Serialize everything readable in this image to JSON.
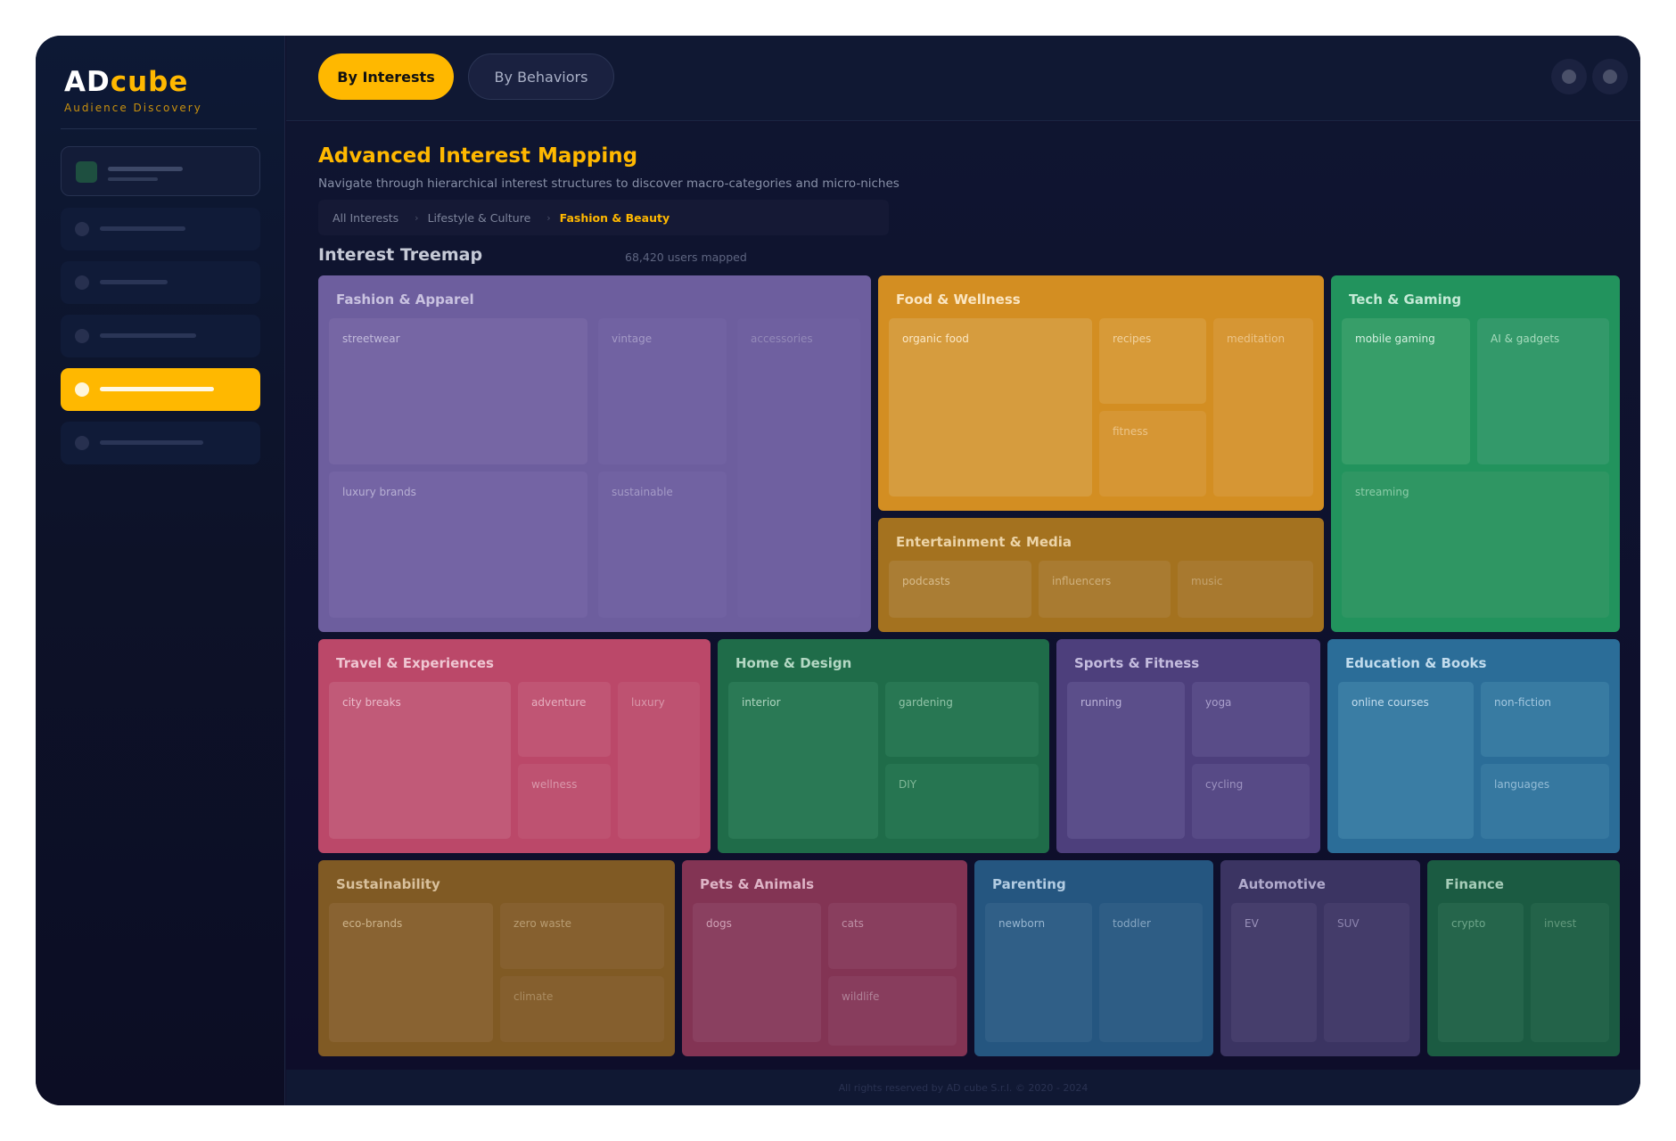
{
  "app": {
    "logo_part1": "AD",
    "logo_part2": "cube",
    "logo_subtitle": "Audience Discovery",
    "accent_color": "#ffb800"
  },
  "tabs": [
    {
      "label": "By Interests",
      "active": true
    },
    {
      "label": "By Behaviors",
      "active": false
    }
  ],
  "main": {
    "title": "Advanced Interest Mapping",
    "subtitle": "Navigate through hierarchical interest structures to discover macro-categories and micro-niches",
    "breadcrumb": [
      "All Interests",
      "Lifestyle & Culture",
      "Fashion & Beauty"
    ],
    "breadcrumb_separator": "›",
    "treemap_title": "Interest Treemap",
    "treemap_count": "68,420 users mapped"
  },
  "treemap": {
    "fashion": {
      "title": "Fashion & Apparel",
      "subs": [
        "streetwear",
        "vintage",
        "accessories",
        "luxury brands",
        "sustainable"
      ]
    },
    "food": {
      "title": "Food & Wellness",
      "subs": [
        "organic food",
        "recipes",
        "meditation",
        "fitness"
      ]
    },
    "entertainment": {
      "title": "Entertainment & Media",
      "subs": [
        "podcasts",
        "influencers",
        "music"
      ]
    },
    "tech": {
      "title": "Tech & Gaming",
      "subs": [
        "mobile gaming",
        "AI & gadgets",
        "streaming"
      ]
    },
    "travel": {
      "title": "Travel & Experiences",
      "subs": [
        "city breaks",
        "adventure",
        "luxury",
        "wellness"
      ]
    },
    "home": {
      "title": "Home & Design",
      "subs": [
        "interior",
        "gardening",
        "DIY"
      ]
    },
    "sports": {
      "title": "Sports & Fitness",
      "subs": [
        "running",
        "yoga",
        "cycling"
      ]
    },
    "education": {
      "title": "Education & Books",
      "subs": [
        "online courses",
        "non-fiction",
        "languages"
      ]
    },
    "sustainability": {
      "title": "Sustainability",
      "subs": [
        "eco-brands",
        "zero waste",
        "climate"
      ]
    },
    "pets": {
      "title": "Pets & Animals",
      "subs": [
        "dogs",
        "cats",
        "wildlife"
      ]
    },
    "parenting": {
      "title": "Parenting",
      "subs": [
        "newborn",
        "toddler"
      ]
    },
    "automotive": {
      "title": "Automotive",
      "subs": [
        "EV",
        "SUV"
      ]
    },
    "finance": {
      "title": "Finance",
      "subs": [
        "crypto",
        "invest"
      ]
    }
  },
  "footer": "All rights reserved by AD cube S.r.l. © 2020 - 2024"
}
